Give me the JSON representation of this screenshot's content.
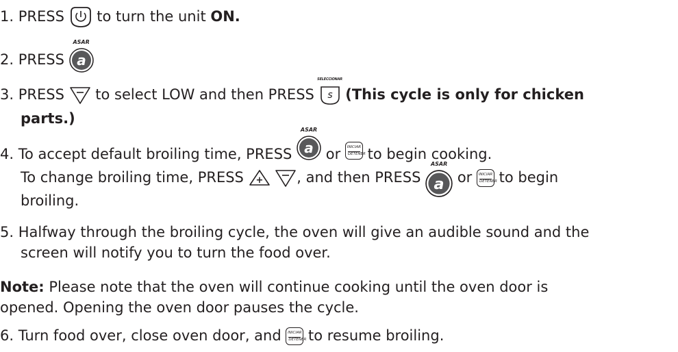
{
  "step1": {
    "num": "1.",
    "press": "PRESS",
    "rest": "to turn the unit",
    "bold": "ON."
  },
  "step2": {
    "num": "2.",
    "press": "PRESS"
  },
  "step3": {
    "num": "3.",
    "press": "PRESS",
    "mid": "to select LOW and then PRESS",
    "bold1": "(This cycle is only for chicken",
    "bold2": "parts.)"
  },
  "step4": {
    "num": "4.",
    "a_pre": "To accept default broiling time, PRESS",
    "a_or": "or",
    "a_post": "to begin cooking.",
    "b_pre": "To change broiling time, PRESS",
    "b_comma": ", and then PRESS",
    "b_or": "or",
    "b_post": "to begin",
    "c": "broiling."
  },
  "step5": {
    "num": "5.",
    "l1": "Halfway through the broiling cycle, the oven will give an audible sound and the",
    "l2": "screen will notify you to turn the food over."
  },
  "note": {
    "label": "Note:",
    "l1": " Please note that the oven will continue cooking until the oven door is",
    "l2": "opened. Opening the oven door pauses the cycle."
  },
  "step6": {
    "num": "6.",
    "pre": "Turn food over, close oven door, and",
    "post": "to resume broiling."
  },
  "icons": {
    "asar": "ASAR",
    "a": "a",
    "s": "s",
    "seleccionar": "SELECCIONAR",
    "iniciar": "INICIAR",
    "detener": "DETENER",
    "plus": "+"
  },
  "icon_names": [
    "power-icon",
    "asar-a-icon",
    "down-arrow-icon",
    "select-s-icon",
    "start-stop-icon",
    "up-arrow-plus-icon"
  ]
}
